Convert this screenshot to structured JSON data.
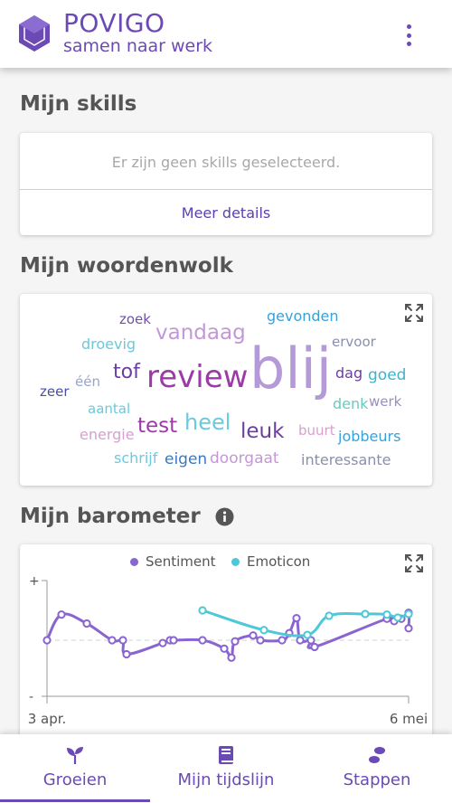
{
  "header": {
    "title": "POVIGO",
    "subtitle": "samen naar werk",
    "logo_icon": "hexagon-icon",
    "menu_icon": "kebab-menu-icon"
  },
  "skills": {
    "title": "Mijn skills",
    "empty_text": "Er zijn geen skills geselecteerd.",
    "details_label": "Meer details"
  },
  "wordcloud": {
    "title": "Mijn woordenwolk",
    "words": [
      {
        "text": "zoek",
        "color": "#6f52a6"
      },
      {
        "text": "gevonden",
        "color": "#3aa0d8"
      },
      {
        "text": "vandaag",
        "color": "#c497d6"
      },
      {
        "text": "droevig",
        "color": "#6bc9d8"
      },
      {
        "text": "ervoor",
        "color": "#8a8fb0"
      },
      {
        "text": "blij",
        "color": "#b49ad6"
      },
      {
        "text": "tof",
        "color": "#6b3fa0"
      },
      {
        "text": "review",
        "color": "#9c3aa8"
      },
      {
        "text": "dag",
        "color": "#6b3fa0"
      },
      {
        "text": "goed",
        "color": "#3ab4d0"
      },
      {
        "text": "één",
        "color": "#9aa4c8"
      },
      {
        "text": "zeer",
        "color": "#4a4ea8"
      },
      {
        "text": "denk",
        "color": "#6cc9bd"
      },
      {
        "text": "werk",
        "color": "#9a8fc0"
      },
      {
        "text": "aantal",
        "color": "#6bc9d8"
      },
      {
        "text": "test",
        "color": "#9c3aa8"
      },
      {
        "text": "heel",
        "color": "#6bc9e0"
      },
      {
        "text": "leuk",
        "color": "#6b3fa0"
      },
      {
        "text": "energie",
        "color": "#d7a0d0"
      },
      {
        "text": "buurt",
        "color": "#d7a0d0"
      },
      {
        "text": "jobbeurs",
        "color": "#3aa0d8"
      },
      {
        "text": "schrijf",
        "color": "#6bc9e0"
      },
      {
        "text": "eigen",
        "color": "#3a78c0"
      },
      {
        "text": "doorgaat",
        "color": "#c497d6"
      },
      {
        "text": "interessante",
        "color": "#8a8fb0"
      }
    ]
  },
  "barometer": {
    "title": "Mijn barometer",
    "info_icon": "info-icon",
    "expand_icon": "expand-icon"
  },
  "chart_data": {
    "type": "line",
    "legend_position": "top-center",
    "y_tick_labels": [
      "+",
      "-"
    ],
    "x_tick_labels": [
      "3 apr.",
      "6 mei"
    ],
    "ylim": [
      -1,
      1
    ],
    "series": [
      {
        "name": "Sentiment",
        "color": "#8a64d0",
        "points": [
          {
            "x": 0.0,
            "y": 0.0
          },
          {
            "x": 0.04,
            "y": 0.43
          },
          {
            "x": 0.11,
            "y": 0.28
          },
          {
            "x": 0.18,
            "y": 0.0
          },
          {
            "x": 0.21,
            "y": 0.0
          },
          {
            "x": 0.22,
            "y": -0.25
          },
          {
            "x": 0.32,
            "y": -0.05
          },
          {
            "x": 0.34,
            "y": 0.0
          },
          {
            "x": 0.35,
            "y": 0.0
          },
          {
            "x": 0.43,
            "y": 0.0
          },
          {
            "x": 0.49,
            "y": -0.15
          },
          {
            "x": 0.51,
            "y": -0.31
          },
          {
            "x": 0.52,
            "y": -0.02
          },
          {
            "x": 0.57,
            "y": 0.08
          },
          {
            "x": 0.59,
            "y": 0.0
          },
          {
            "x": 0.65,
            "y": 0.0
          },
          {
            "x": 0.67,
            "y": 0.12
          },
          {
            "x": 0.69,
            "y": 0.37
          },
          {
            "x": 0.7,
            "y": 0.0
          },
          {
            "x": 0.73,
            "y": 0.0
          },
          {
            "x": 0.74,
            "y": -0.12
          },
          {
            "x": 0.94,
            "y": 0.36
          },
          {
            "x": 0.96,
            "y": 0.32
          },
          {
            "x": 0.98,
            "y": 0.36
          },
          {
            "x": 1.0,
            "y": 0.46
          },
          {
            "x": 1.0,
            "y": 0.2
          }
        ]
      },
      {
        "name": "Emoticon",
        "color": "#4cc8d8",
        "points": [
          {
            "x": 0.43,
            "y": 0.5
          },
          {
            "x": 0.6,
            "y": 0.17
          },
          {
            "x": 0.72,
            "y": 0.09
          },
          {
            "x": 0.78,
            "y": 0.41
          },
          {
            "x": 0.88,
            "y": 0.44
          },
          {
            "x": 0.94,
            "y": 0.43
          },
          {
            "x": 0.97,
            "y": 0.38
          },
          {
            "x": 1.0,
            "y": 0.44
          }
        ]
      }
    ]
  },
  "nav": {
    "items": [
      {
        "label": "Groeien",
        "icon": "sprout-icon",
        "active": true
      },
      {
        "label": "Mijn tijdslijn",
        "icon": "book-icon",
        "active": false
      },
      {
        "label": "Stappen",
        "icon": "footsteps-icon",
        "active": false
      }
    ]
  },
  "colors": {
    "brand": "#6c4ab6",
    "text": "#555555",
    "muted": "#a8a8a8"
  }
}
